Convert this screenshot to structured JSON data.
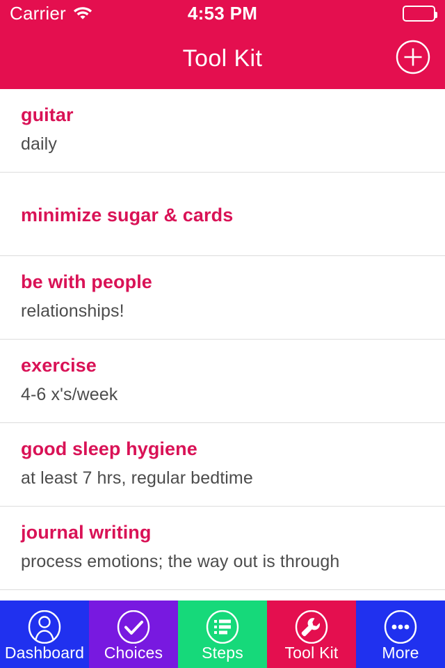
{
  "status_bar": {
    "carrier": "Carrier",
    "wifi_icon": "wifi-icon",
    "time": "4:53 PM",
    "battery_icon": "battery-full-icon"
  },
  "navbar": {
    "title": "Tool Kit",
    "add_button_icon": "plus-circle-icon",
    "background_color": "#e40f4f",
    "text_color": "#ffffff"
  },
  "list": {
    "title_color": "#d91256",
    "subtitle_color": "#4c4c4c",
    "separator_color": "#dcdcdc",
    "items": [
      {
        "title": "guitar",
        "subtitle": "daily"
      },
      {
        "title": "minimize sugar & cards",
        "subtitle": ""
      },
      {
        "title": "be with people",
        "subtitle": "relationships!"
      },
      {
        "title": "exercise",
        "subtitle": "4-6 x's/week"
      },
      {
        "title": "good sleep hygiene",
        "subtitle": "at least 7 hrs, regular bedtime"
      },
      {
        "title": "journal writing",
        "subtitle": "process emotions; the way out is through"
      }
    ]
  },
  "tabbar": {
    "active_tab": "Tool Kit",
    "tabs": [
      {
        "label": "Dashboard",
        "icon": "person-circle-icon",
        "color": "#2031ef"
      },
      {
        "label": "Choices",
        "icon": "check-circle-icon",
        "color": "#7819e0"
      },
      {
        "label": "Steps",
        "icon": "list-circle-icon",
        "color": "#16d97a"
      },
      {
        "label": "Tool Kit",
        "icon": "wrench-circle-icon",
        "color": "#e40f4f"
      },
      {
        "label": "More",
        "icon": "ellipsis-circle-icon",
        "color": "#2031ef"
      }
    ]
  }
}
